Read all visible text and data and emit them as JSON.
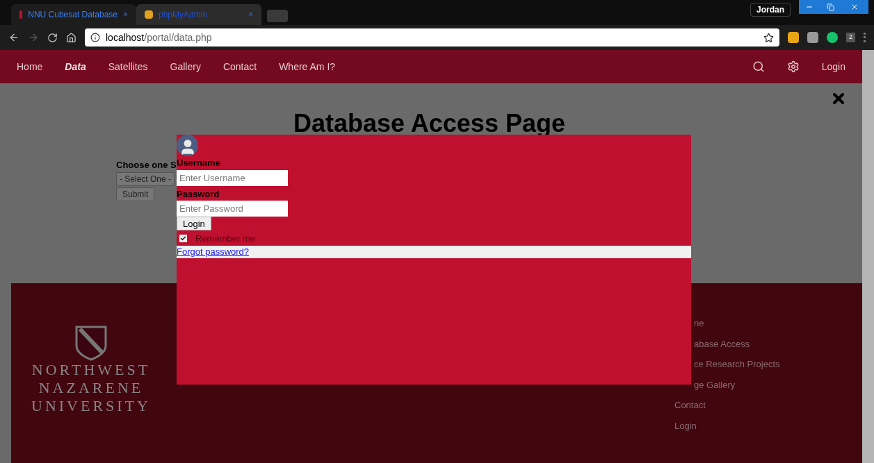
{
  "browser": {
    "tabs": [
      {
        "label": "NNU Cubesat Database",
        "selected": true
      },
      {
        "label": "phpMyAdmin",
        "selected": false
      }
    ],
    "tab_close": "×",
    "profile": "Jordan",
    "address": {
      "host": "localhost",
      "path": "/portal/data.php"
    },
    "extension_badge": "2"
  },
  "navbar": {
    "items": [
      {
        "label": "Home",
        "selected": false
      },
      {
        "label": "Data",
        "selected": true
      },
      {
        "label": "Satellites",
        "selected": false
      },
      {
        "label": "Gallery",
        "selected": false
      },
      {
        "label": "Contact",
        "selected": false
      },
      {
        "label": "Where Am I?",
        "selected": false
      }
    ],
    "login": "Login"
  },
  "page": {
    "title": "Database Access Page",
    "choose_label": "Choose one S",
    "select_value": "- Select One -",
    "submit": "Submit"
  },
  "modal": {
    "username_label": "Username",
    "username_placeholder": "Enter Username",
    "password_label": "Password",
    "password_placeholder": "Enter Password",
    "login_button": "Login",
    "remember": {
      "label": "Remember me",
      "checked": true
    },
    "forgot_link": "Forgot password?"
  },
  "footer": {
    "logo_lines": [
      "NORTHWEST",
      "NAZARENE",
      "UNIVERSITY"
    ],
    "links": [
      "ne",
      "abase Access",
      "ce Research Projects",
      "ge Gallery",
      "Contact",
      "Login"
    ]
  }
}
